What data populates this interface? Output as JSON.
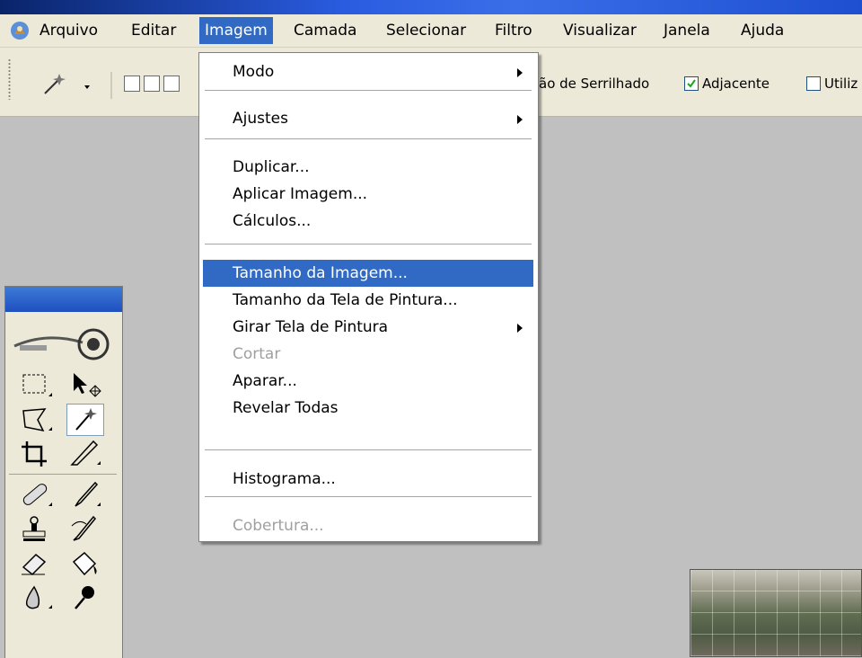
{
  "menubar": {
    "items": [
      {
        "label": "Arquivo"
      },
      {
        "label": "Editar"
      },
      {
        "label": "Imagem"
      },
      {
        "label": "Camada"
      },
      {
        "label": "Selecionar"
      },
      {
        "label": "Filtro"
      },
      {
        "label": "Visualizar"
      },
      {
        "label": "Janela"
      },
      {
        "label": "Ajuda"
      }
    ],
    "active": "Imagem"
  },
  "options": {
    "antialias_label": "ão de Serrilhado",
    "contiguous_label": "Adjacente",
    "contiguous_checked": true,
    "use_all_label": "Utiliz",
    "use_all_checked": false
  },
  "image_menu": {
    "items": [
      {
        "label": "Modo",
        "submenu": true
      },
      {
        "label": "Ajustes",
        "submenu": true
      },
      {
        "label": "Duplicar..."
      },
      {
        "label": "Aplicar Imagem..."
      },
      {
        "label": "Cálculos..."
      },
      {
        "label": "Tamanho da Imagem...",
        "highlighted": true
      },
      {
        "label": "Tamanho da Tela de Pintura..."
      },
      {
        "label": "Girar Tela de Pintura",
        "submenu": true
      },
      {
        "label": "Cortar",
        "disabled": true
      },
      {
        "label": "Aparar..."
      },
      {
        "label": "Revelar Todas"
      },
      {
        "label": "Histograma..."
      },
      {
        "label": "Cobertura...",
        "disabled": true
      }
    ]
  },
  "colors": {
    "accent": "#316ac5",
    "menubar_bg": "#ece9d8",
    "workspace_bg": "#c0c0c0"
  },
  "icons": {
    "app": "photoshop-app-icon",
    "tool_preset": "magic-wand-icon",
    "toolbox": [
      "marquee-icon",
      "move-icon",
      "lasso-icon",
      "magic-wand-icon",
      "crop-icon",
      "slice-icon",
      "healing-brush-icon",
      "brush-icon",
      "clone-stamp-icon",
      "history-brush-icon",
      "eraser-icon",
      "paint-bucket-icon",
      "blur-icon",
      "dodge-icon"
    ]
  }
}
